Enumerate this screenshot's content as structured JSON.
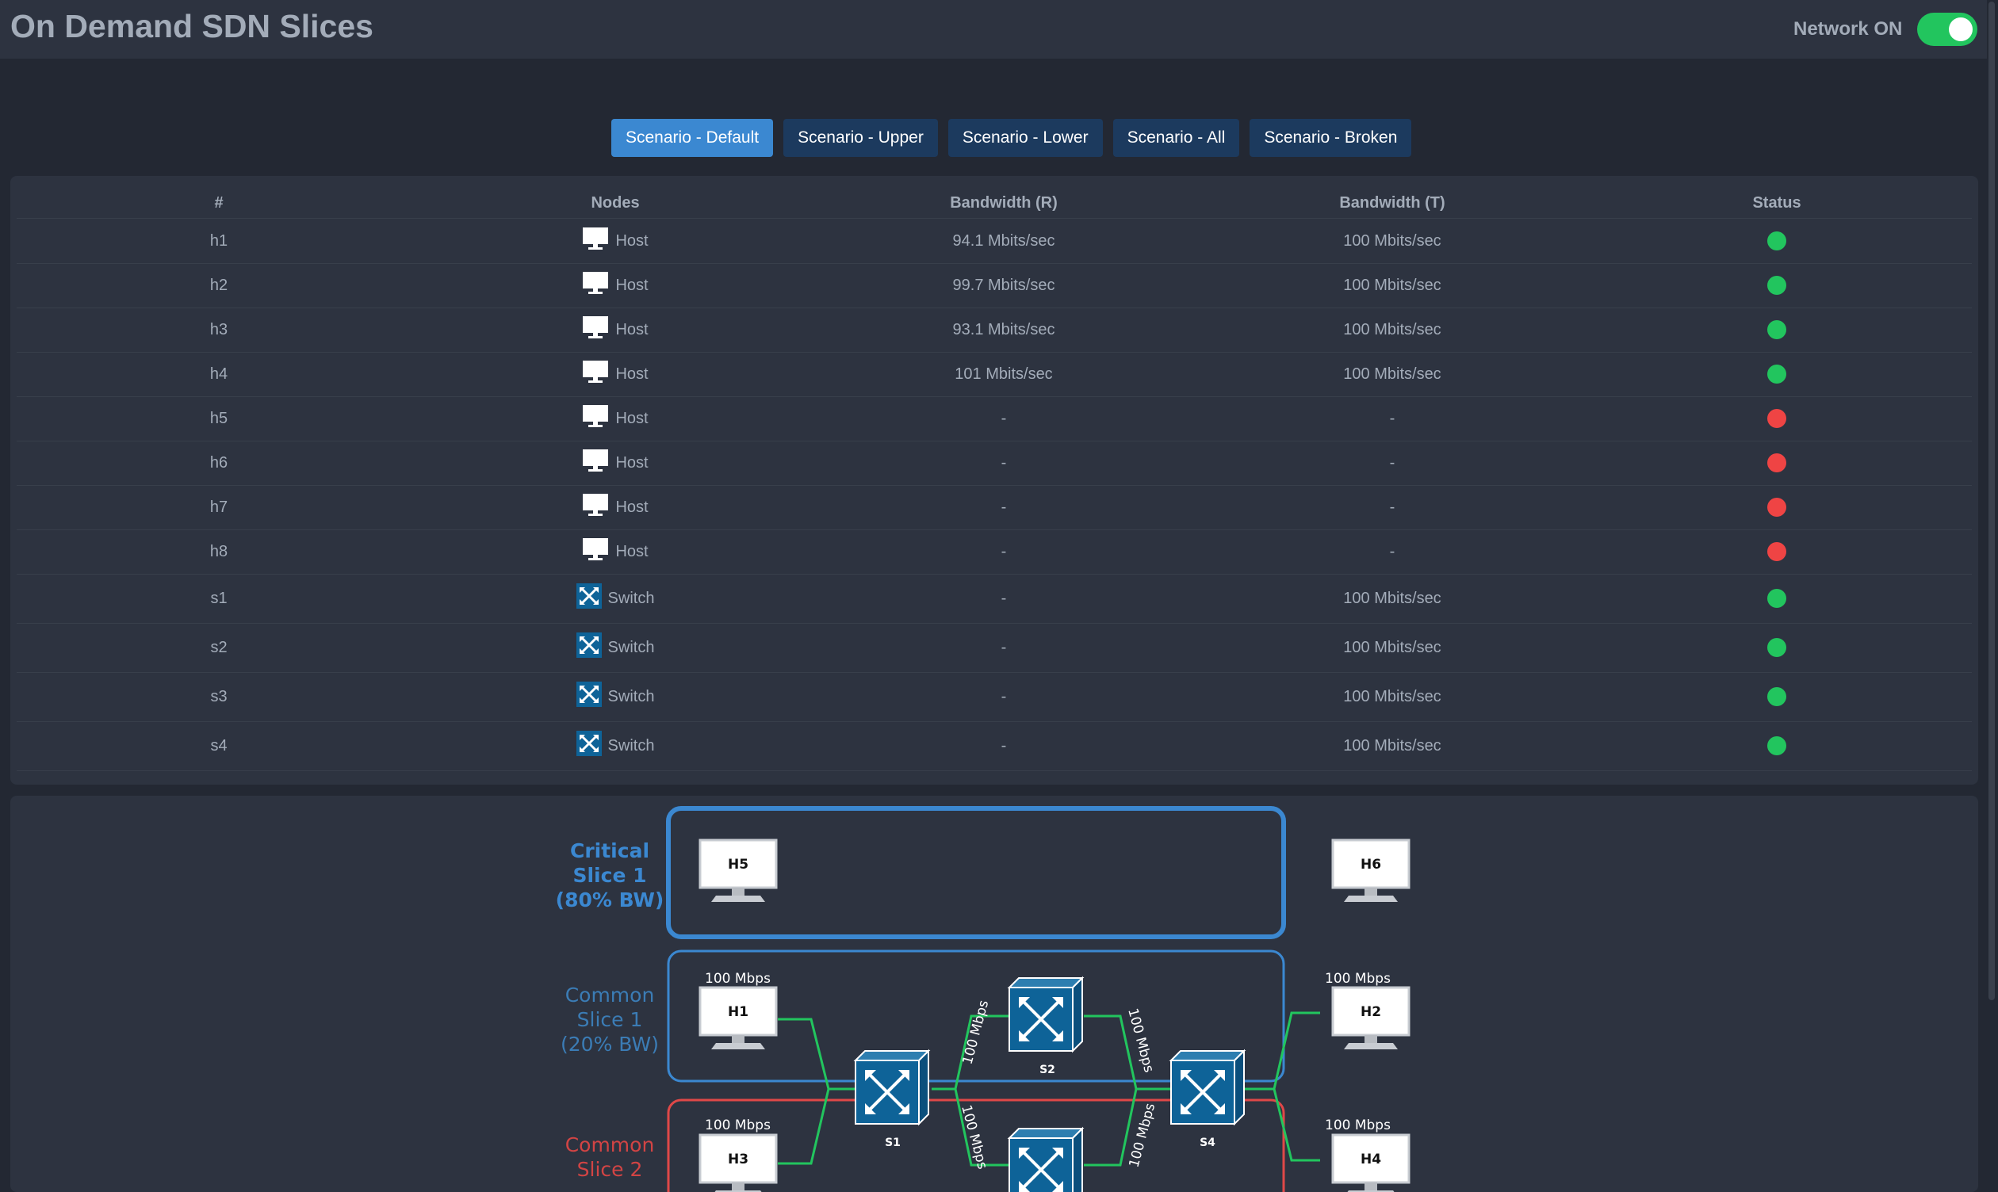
{
  "app": {
    "title": "On Demand SDN Slices"
  },
  "network": {
    "label": "Network ON",
    "on": true,
    "on_color": "#22c55e"
  },
  "scenarios": [
    {
      "label": "Scenario - Default",
      "active": true
    },
    {
      "label": "Scenario - Upper",
      "active": false
    },
    {
      "label": "Scenario - Lower",
      "active": false
    },
    {
      "label": "Scenario - All",
      "active": false
    },
    {
      "label": "Scenario - Broken",
      "active": false
    }
  ],
  "table": {
    "headers": {
      "id": "#",
      "nodes": "Nodes",
      "bw_r": "Bandwidth (R)",
      "bw_t": "Bandwidth (T)",
      "status": "Status"
    },
    "rows": [
      {
        "id": "h1",
        "node_type": "Host",
        "icon": "monitor-icon",
        "bw_r": "94.1 Mbits/sec",
        "bw_t": "100 Mbits/sec",
        "status": "up"
      },
      {
        "id": "h2",
        "node_type": "Host",
        "icon": "monitor-icon",
        "bw_r": "99.7 Mbits/sec",
        "bw_t": "100 Mbits/sec",
        "status": "up"
      },
      {
        "id": "h3",
        "node_type": "Host",
        "icon": "monitor-icon",
        "bw_r": "93.1 Mbits/sec",
        "bw_t": "100 Mbits/sec",
        "status": "up"
      },
      {
        "id": "h4",
        "node_type": "Host",
        "icon": "monitor-icon",
        "bw_r": "101 Mbits/sec",
        "bw_t": "100 Mbits/sec",
        "status": "up"
      },
      {
        "id": "h5",
        "node_type": "Host",
        "icon": "monitor-icon",
        "bw_r": "-",
        "bw_t": "-",
        "status": "down"
      },
      {
        "id": "h6",
        "node_type": "Host",
        "icon": "monitor-icon",
        "bw_r": "-",
        "bw_t": "-",
        "status": "down"
      },
      {
        "id": "h7",
        "node_type": "Host",
        "icon": "monitor-icon",
        "bw_r": "-",
        "bw_t": "-",
        "status": "down"
      },
      {
        "id": "h8",
        "node_type": "Host",
        "icon": "monitor-icon",
        "bw_r": "-",
        "bw_t": "-",
        "status": "down"
      },
      {
        "id": "s1",
        "node_type": "Switch",
        "icon": "switch-icon",
        "bw_r": "-",
        "bw_t": "100 Mbits/sec",
        "status": "up"
      },
      {
        "id": "s2",
        "node_type": "Switch",
        "icon": "switch-icon",
        "bw_r": "-",
        "bw_t": "100 Mbits/sec",
        "status": "up"
      },
      {
        "id": "s3",
        "node_type": "Switch",
        "icon": "switch-icon",
        "bw_r": "-",
        "bw_t": "100 Mbits/sec",
        "status": "up"
      },
      {
        "id": "s4",
        "node_type": "Switch",
        "icon": "switch-icon",
        "bw_r": "-",
        "bw_t": "100 Mbits/sec",
        "status": "up"
      }
    ],
    "status_colors": {
      "up": "#22c55e",
      "down": "#ef4444"
    }
  },
  "diagram": {
    "slices": [
      {
        "name": "critical-slice-1",
        "label_lines": [
          "Critical",
          "Slice 1",
          "(80% BW)"
        ],
        "color": "#3b88d1"
      },
      {
        "name": "common-slice-1",
        "label_lines": [
          "Common",
          "Slice 1",
          "(20% BW)"
        ],
        "color": "#3b88d1"
      },
      {
        "name": "common-slice-2",
        "label_lines": [
          "Common",
          "Slice 2"
        ],
        "color": "#e04848"
      }
    ],
    "hosts": {
      "h5": "H5",
      "h6": "H6",
      "h1": "H1",
      "h2": "H2",
      "h3": "H3",
      "h4": "H4"
    },
    "switches": {
      "s1": "S1",
      "s2": "S2",
      "s4": "S4"
    },
    "link_label": "100 Mbps",
    "link_color": "#22c55e"
  }
}
